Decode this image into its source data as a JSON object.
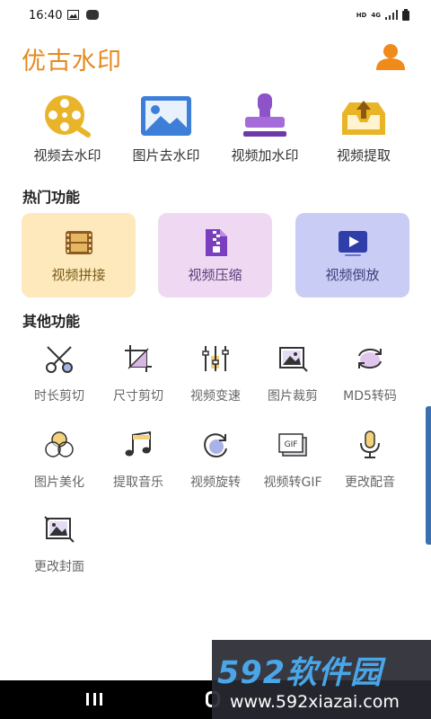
{
  "status_bar": {
    "time": "16:40",
    "indicators": [
      "HD",
      "4G"
    ],
    "icons": [
      "gallery-icon",
      "notification-badge-icon",
      "signal-icon",
      "battery-icon"
    ]
  },
  "app": {
    "title": "优古水印",
    "title_color": "#e58a1f"
  },
  "top_features": [
    {
      "label": "视频去水印",
      "icon": "film-reel-magnifier-icon"
    },
    {
      "label": "图片去水印",
      "icon": "picture-icon"
    },
    {
      "label": "视频加水印",
      "icon": "stamp-icon"
    },
    {
      "label": "视频提取",
      "icon": "tray-upload-icon"
    }
  ],
  "sections": {
    "hot": "热门功能",
    "other": "其他功能"
  },
  "hot_features": [
    {
      "label": "视频拼接",
      "icon": "film-strip-icon",
      "bg": "#fde9bb",
      "color": "#7a5a1a"
    },
    {
      "label": "视频压缩",
      "icon": "zip-file-icon",
      "bg": "#efd9f2",
      "color": "#5a3a7a"
    },
    {
      "label": "视频倒放",
      "icon": "play-screen-icon",
      "bg": "#c9ccf4",
      "color": "#3a3f7a"
    }
  ],
  "other_features": [
    {
      "label": "时长剪切",
      "icon": "scissors-icon"
    },
    {
      "label": "尺寸剪切",
      "icon": "crop-icon"
    },
    {
      "label": "视频变速",
      "icon": "sliders-icon"
    },
    {
      "label": "图片裁剪",
      "icon": "image-crop-icon"
    },
    {
      "label": "MD5转码",
      "icon": "refresh-cycle-icon"
    },
    {
      "label": "图片美化",
      "icon": "color-circles-icon"
    },
    {
      "label": "提取音乐",
      "icon": "music-note-icon"
    },
    {
      "label": "视频旋转",
      "icon": "rotate-icon"
    },
    {
      "label": "视频转GIF",
      "icon": "gif-icon"
    },
    {
      "label": "更改配音",
      "icon": "microphone-icon"
    },
    {
      "label": "更改封面",
      "icon": "cover-image-icon"
    }
  ],
  "watermark": {
    "brand": "592软件园",
    "url": "www.592xiazai.com"
  }
}
